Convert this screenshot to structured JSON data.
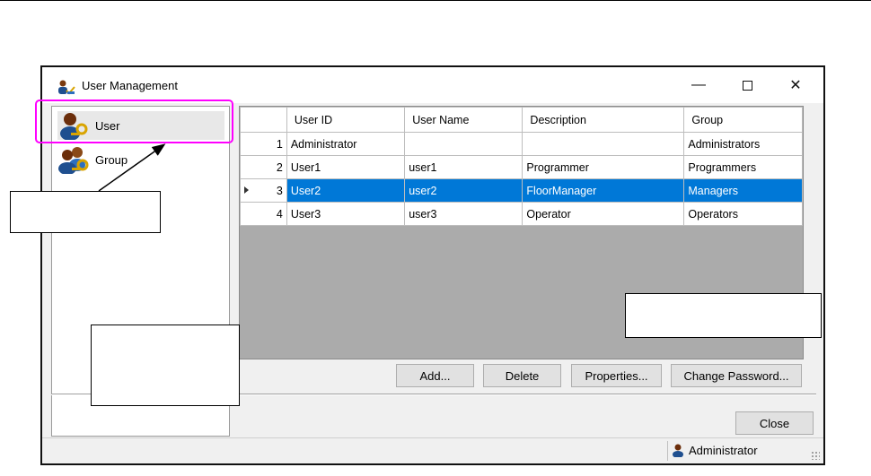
{
  "window": {
    "title": "User Management",
    "controls": {
      "minimize": "—",
      "close": "✕"
    }
  },
  "sidebar": {
    "items": [
      {
        "label": "User",
        "icon": "user-key-icon",
        "selected": true
      },
      {
        "label": "Group",
        "icon": "group-key-icon",
        "selected": false
      }
    ]
  },
  "grid": {
    "columns": [
      "User ID",
      "User Name",
      "Description",
      "Group"
    ],
    "rows": [
      {
        "num": "1",
        "user_id": "Administrator",
        "user_name": "",
        "description": "",
        "group": "Administrators"
      },
      {
        "num": "2",
        "user_id": "User1",
        "user_name": "user1",
        "description": "Programmer",
        "group": "Programmers"
      },
      {
        "num": "3",
        "user_id": "User2",
        "user_name": "user2",
        "description": "FloorManager",
        "group": "Managers",
        "selected": true
      },
      {
        "num": "4",
        "user_id": "User3",
        "user_name": "user3",
        "description": "Operator",
        "group": "Operators"
      }
    ]
  },
  "buttons": {
    "add": "Add...",
    "delete": "Delete",
    "properties": "Properties...",
    "change_password": "Change Password...",
    "close": "Close"
  },
  "status": {
    "user": "Administrator"
  },
  "colors": {
    "selection": "#0078d7",
    "highlight": "#ff00ff"
  }
}
